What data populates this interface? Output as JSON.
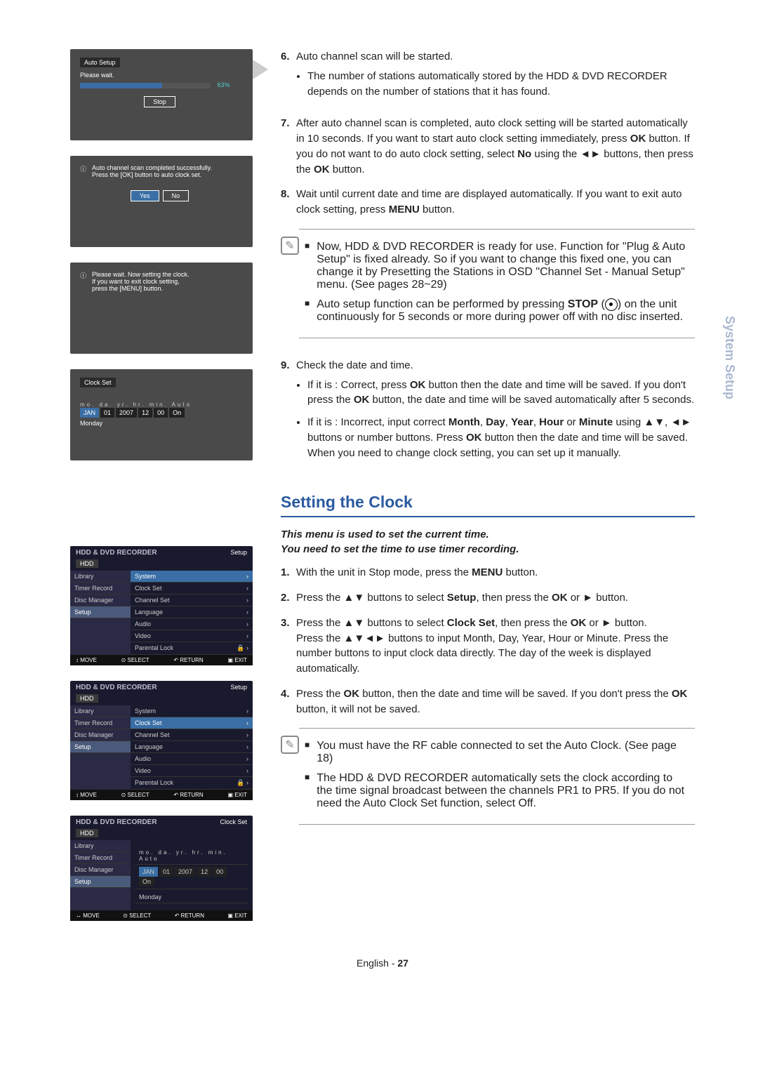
{
  "sideTab": "System Setup",
  "screens": {
    "s1": {
      "title": "Auto Setup",
      "msg": "Please wait.",
      "pct": "63%",
      "btn": "Stop"
    },
    "s2": {
      "line1": "Auto channel scan completed successfully.",
      "line2": "Press the [OK] button to auto clock set.",
      "yes": "Yes",
      "no": "No"
    },
    "s3": {
      "line1": "Please wait. Now setting the clock.",
      "line2": "If you want to exit clock setting,",
      "line3": "press the [MENU] button."
    },
    "s4": {
      "title": "Clock Set",
      "labels": "mo.   da.    yr.    hr.   min.  Auto",
      "mo": "JAN",
      "da": "01",
      "yr": "2007",
      "hr": "12",
      "mn": "00",
      "auto": "On",
      "day": "Monday"
    }
  },
  "menus": {
    "hdr": "HDD & DVD RECORDER",
    "right1": "Setup",
    "right2": "Setup",
    "right3": "Clock Set",
    "hdd": "HDD",
    "left": [
      "Library",
      "Timer Record",
      "Disc Manager",
      "Setup"
    ],
    "r": [
      "System",
      "Clock Set",
      "Channel Set",
      "Language",
      "Audio",
      "Video",
      "Parental Lock"
    ],
    "foot": {
      "move": "MOVE",
      "sel": "SELECT",
      "ret": "RETURN",
      "exit": "EXIT"
    },
    "clockLabels": "mo.   da.   yr.    hr.   min.  Auto",
    "mo": "JAN",
    "da": "01",
    "yr": "2007",
    "hr": "12",
    "mn": "00",
    "auto": "On",
    "day": "Monday"
  },
  "steps": {
    "n6": "6.",
    "t6": "Auto channel scan will be started.",
    "b6": "The number of stations automatically stored by the HDD & DVD RECORDER depends on the number of stations that it has found.",
    "n7": "7.",
    "t7a": "After auto channel scan is completed, auto clock setting will be started automatically in 10 seconds. If you want to start auto clock setting immediately, press ",
    "t7b": " button. If you do not want to do auto clock setting, select ",
    "t7no": "No",
    "t7c": " using the ◄► buttons, then press the ",
    "t7d": " button.",
    "OK": "OK",
    "n8": "8.",
    "t8a": "Wait until current date and time are displayed automatically. If you want to exit auto clock setting, press ",
    "MENU": "MENU",
    "t8b": " button.",
    "co1a": "Now, HDD & DVD RECORDER is ready for use. Function for \"Plug & Auto Setup\" is fixed already. So if you want to change this fixed one, you can change it by Presetting the Stations in OSD \"Channel Set - Manual Setup\" menu. (See pages 28~29)",
    "co1b_a": "Auto setup function can be performed by pressing ",
    "STOP": "STOP",
    "co1b_b": " on the unit continuously for 5 seconds or more during power off with no disc inserted.",
    "n9": "9.",
    "t9": "Check the date and time.",
    "b9a_a": "If it is : Correct, press ",
    "b9a_b": " button then the date and time will be saved. If you don't press the ",
    "b9a_c": " button, the date and time will be saved automatically after 5 seconds.",
    "b9b_a": "If it is : Incorrect, input correct ",
    "Month": "Month",
    "Day": "Day",
    "Year": "Year",
    "Hour": "Hour",
    "Minute": "Minute",
    "b9b_b": " using ▲▼, ◄► buttons or number buttons. Press ",
    "b9b_c": " button then the date and time will be saved. When you need to change clock setting, you can set up it manually."
  },
  "clockSec": {
    "h": "Setting the Clock",
    "intro": "This menu is used to set the current time.\nYou need to set the time to use timer recording.",
    "n1": "1.",
    "t1a": "With the unit in Stop mode, press the ",
    "t1b": " button.",
    "n2": "2.",
    "t2a": "Press the ▲▼ buttons to select ",
    "Setup": "Setup",
    "t2b": ", then press the ",
    "t2c": " or ► button.",
    "n3": "3.",
    "t3a": "Press the ▲▼  buttons to select ",
    "CS": "Clock Set",
    "t3b": ", then press the ",
    "t3c": " or ► button.",
    "t3d": "Press the ▲▼◄► buttons to input Month, Day, Year, Hour or Minute. Press the number buttons to input clock data directly. The day of the week is displayed automatically.",
    "n4": "4.",
    "t4a": "Press the ",
    "t4b": " button, then the date and time will be saved. If you don't press the ",
    "t4c": " button, it will not be saved.",
    "co2a": "You must have the RF cable connected to set the Auto Clock. (See page 18)",
    "co2b": "The HDD & DVD RECORDER automatically sets the clock according to the time signal broadcast between the channels PR1 to PR5. If you do not need the Auto Clock Set function, select Off."
  },
  "footer": {
    "lang": "English - ",
    "page": "27"
  }
}
